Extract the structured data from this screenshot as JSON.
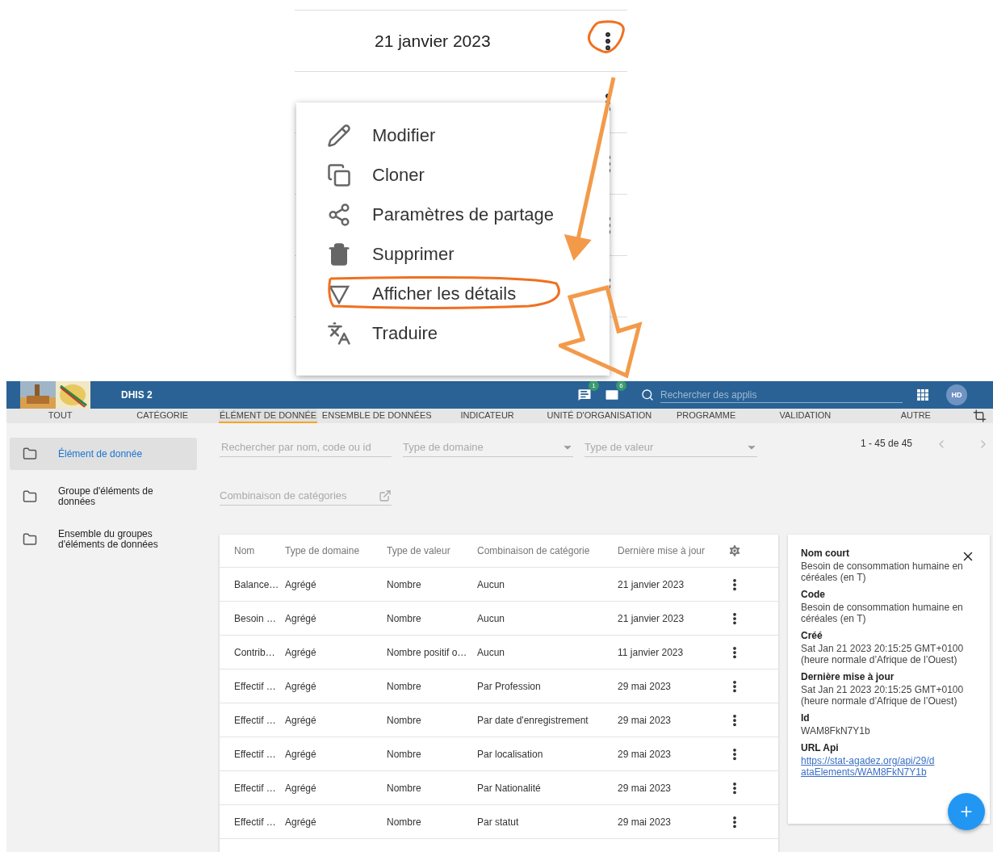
{
  "zoomed_list": {
    "rows": [
      {
        "date": "21 janvier 2023",
        "circled": true
      },
      {
        "circled": false
      },
      {
        "circled": false
      },
      {
        "circled": false
      },
      {
        "circled": false
      }
    ]
  },
  "context_menu": {
    "items": [
      {
        "label": "Modifier",
        "circled": false
      },
      {
        "label": "Cloner",
        "circled": false
      },
      {
        "label": "Paramètres de partage",
        "circled": false
      },
      {
        "label": "Supprimer",
        "circled": false
      },
      {
        "label": "Afficher les détails",
        "circled": true
      },
      {
        "label": "Traduire",
        "circled": false
      }
    ]
  },
  "header": {
    "app_title": "DHIS 2",
    "notifications": [
      {
        "count": "1"
      },
      {
        "count": "6"
      }
    ],
    "search": {
      "placeholder": "Rechercher des applis"
    },
    "avatar": "HD"
  },
  "tabs": [
    {
      "label": "TOUT",
      "selected": false
    },
    {
      "label": "CATÉGORIE",
      "selected": false
    },
    {
      "label": "ÉLÉMENT DE DONNÉE",
      "selected": true
    },
    {
      "label": "ENSEMBLE DE DONNÉES",
      "selected": false
    },
    {
      "label": "INDICATEUR",
      "selected": false
    },
    {
      "label": "UNITÉ D'ORGANISATION",
      "selected": false
    },
    {
      "label": "PROGRAMME",
      "selected": false
    },
    {
      "label": "VALIDATION",
      "selected": false
    },
    {
      "label": "AUTRE",
      "selected": false
    }
  ],
  "sidebar": {
    "items": [
      {
        "label": "Élément de donnée",
        "selected": true
      },
      {
        "label": "Groupe d'éléments de données",
        "selected": false
      },
      {
        "label": "Ensemble du groupes d'éléments de données",
        "selected": false
      }
    ]
  },
  "filters": {
    "search": {
      "placeholder": "Rechercher par nom, code ou id"
    },
    "domain_type": {
      "placeholder": "Type de domaine"
    },
    "value_type": {
      "placeholder": "Type de valeur"
    },
    "category_combo": {
      "placeholder": "Combinaison de catégories"
    }
  },
  "pagination": "1 - 45 de 45",
  "table": {
    "columns": [
      "Nom",
      "Type de domaine",
      "Type de valeur",
      "Combinaison de catégorie",
      "Dernière mise à jour"
    ],
    "rows": [
      [
        "Balance…",
        "Agrégé",
        "Nombre",
        "Aucun",
        "21 janvier 2023"
      ],
      [
        "Besoin …",
        "Agrégé",
        "Nombre",
        "Aucun",
        "21 janvier 2023"
      ],
      [
        "Contrib…",
        "Agrégé",
        "Nombre positif o…",
        "Aucun",
        "11 janvier 2023"
      ],
      [
        "Effectif …",
        "Agrégé",
        "Nombre",
        "Par Profession",
        "29 mai 2023"
      ],
      [
        "Effectif …",
        "Agrégé",
        "Nombre",
        "Par date d'enregistrement",
        "29 mai 2023"
      ],
      [
        "Effectif …",
        "Agrégé",
        "Nombre",
        "Par localisation",
        "29 mai 2023"
      ],
      [
        "Effectif …",
        "Agrégé",
        "Nombre",
        "Par Nationalité",
        "29 mai 2023"
      ],
      [
        "Effectif …",
        "Agrégé",
        "Nombre",
        "Par statut",
        "29 mai 2023"
      ]
    ]
  },
  "details": {
    "fields": [
      {
        "label": "Nom court",
        "value": "Besoin de consommation humaine en céréales (en T)",
        "kind": "text"
      },
      {
        "label": "Code",
        "value": "Besoin de consommation humaine en céréales (en T)",
        "kind": "text"
      },
      {
        "label": "Créé",
        "value": "Sat Jan 21 2023 20:15:25 GMT+0100 (heure normale d’Afrique de l’Ouest)",
        "kind": "text"
      },
      {
        "label": "Dernière mise à jour",
        "value": "Sat Jan 21 2023 20:15:25 GMT+0100 (heure normale d’Afrique de l’Ouest)",
        "kind": "text"
      },
      {
        "label": "Id",
        "value": "WAM8FkN7Y1b",
        "kind": "text"
      },
      {
        "label": "URL Api",
        "value": "https://stat-agadez.org/api/29/dataElements/WAM8FkN7Y1b",
        "kind": "link"
      }
    ]
  }
}
